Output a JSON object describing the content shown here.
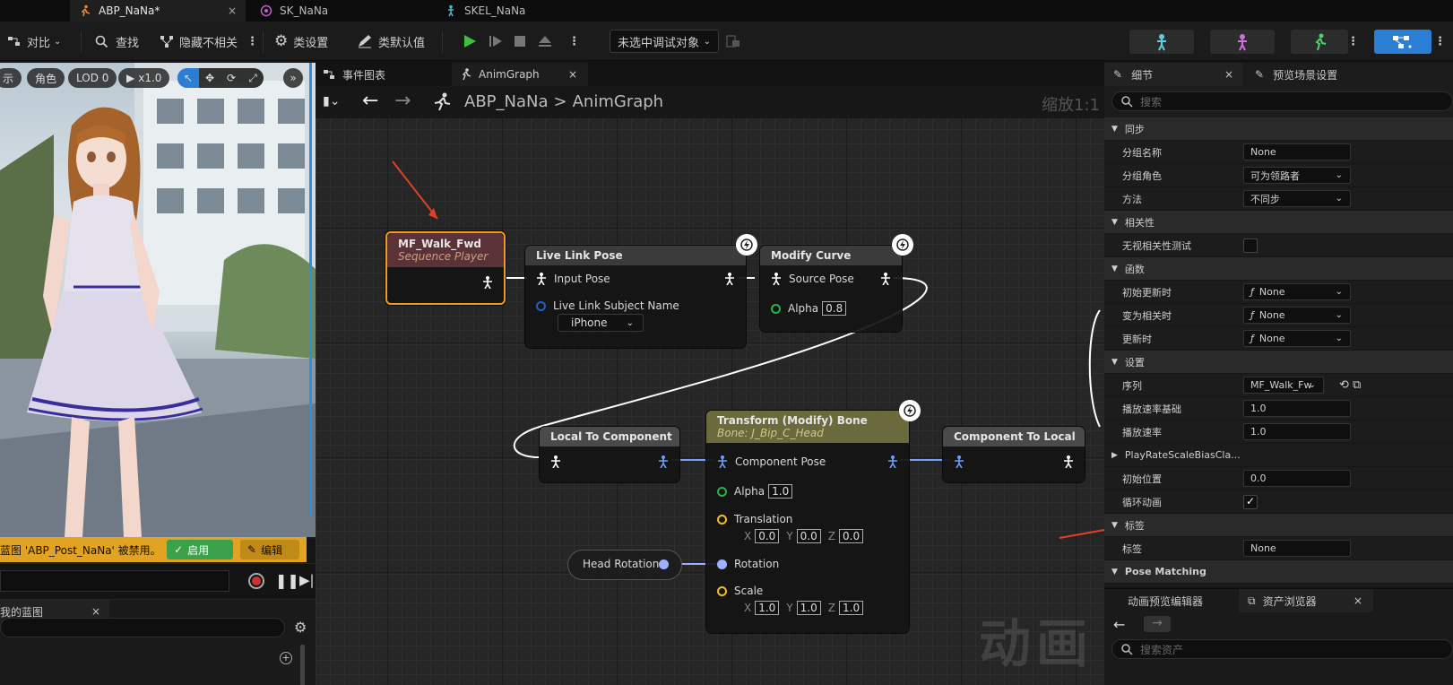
{
  "tabs": [
    {
      "label": "ABP_NaNa*",
      "close": "×"
    },
    {
      "label": "SK_NaNa"
    },
    {
      "label": "SKEL_NaNa"
    }
  ],
  "toolbar": {
    "diff": "对比",
    "find": "查找",
    "hide": "隐藏不相关",
    "class_settings": "类设置",
    "class_defaults": "类默认值",
    "debug_target": "未选中调试对象"
  },
  "viewport": {
    "show": "示",
    "role": "角色",
    "lod": "LOD 0",
    "speed": "x1.0",
    "warning": "蓝图 'ABP_Post_NaNa' 被禁用。",
    "enable": "启用",
    "edit": "编辑"
  },
  "my_blueprint": {
    "title": "我的蓝图",
    "close": "×"
  },
  "graph_tabs": [
    {
      "label": "事件图表"
    },
    {
      "label": "AnimGraph",
      "close": "×"
    }
  ],
  "breadcrumb": {
    "bp": "ABP_NaNa",
    "sep": ">",
    "graph": "AnimGraph",
    "zoom": "缩放1:1"
  },
  "nodes": {
    "seq": {
      "title": "MF_Walk_Fwd",
      "sub": "Sequence Player"
    },
    "livelink": {
      "title": "Live Link Pose",
      "input": "Input Pose",
      "subject": "Live Link Subject Name",
      "subject_value": "iPhone"
    },
    "modcurve": {
      "title": "Modify Curve",
      "source": "Source Pose",
      "alpha": "Alpha",
      "alpha_val": "0.8"
    },
    "l2c": {
      "title": "Local To Component"
    },
    "tmb": {
      "title": "Transform (Modify) Bone",
      "sub": "Bone: J_Bip_C_Head",
      "comp": "Component Pose",
      "alpha": "Alpha",
      "alpha_val": "1.0",
      "translation": "Translation",
      "tx": "0.0",
      "ty": "0.0",
      "tz": "0.0",
      "rotation": "Rotation",
      "scale": "Scale",
      "sx": "1.0",
      "sy": "1.0",
      "sz": "1.0",
      "x": "X",
      "y": "Y",
      "z": "Z"
    },
    "c2l": {
      "title": "Component To Local"
    },
    "headrot": {
      "title": "Head Rotation"
    }
  },
  "watermark": "动画",
  "details": {
    "tab": "细节",
    "tab2": "预览场景设置",
    "search": "搜索",
    "rows": [
      {
        "type": "section",
        "label": "同步"
      },
      {
        "label": "分组名称",
        "value": "None"
      },
      {
        "label": "分组角色",
        "value": "可为领路者",
        "dd": true
      },
      {
        "label": "方法",
        "value": "不同步",
        "dd": true
      },
      {
        "type": "section",
        "label": "相关性"
      },
      {
        "label": "无视相关性测试",
        "check": false
      },
      {
        "type": "section",
        "label": "函数"
      },
      {
        "label": "初始更新时",
        "value": "None",
        "fn": true
      },
      {
        "label": "变为相关时",
        "value": "None",
        "fn": true
      },
      {
        "label": "更新时",
        "value": "None",
        "fn": true
      },
      {
        "type": "section",
        "label": "设置"
      },
      {
        "label": "序列",
        "value": "MF_Walk_Fw",
        "dd": true
      },
      {
        "label": "播放速率基础",
        "value": "1.0"
      },
      {
        "label": "播放速率",
        "value": "1.0"
      },
      {
        "label": "PlayRateScaleBiasCla...",
        "arrow": true
      },
      {
        "label": "初始位置",
        "value": "0.0"
      },
      {
        "label": "循环动画",
        "check": true
      },
      {
        "type": "section",
        "label": "标签"
      },
      {
        "label": "标签",
        "value": "None"
      },
      {
        "type": "section",
        "label": "Pose Matching",
        "bold": true
      }
    ]
  },
  "bottom": {
    "tab1": "动画预览编辑器",
    "tab2": "资产浏览器",
    "close": "×",
    "search": "搜索资产"
  }
}
